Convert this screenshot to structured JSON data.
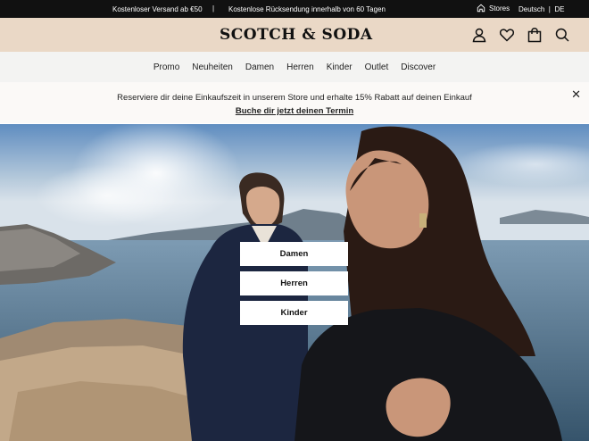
{
  "topbar": {
    "message_shipping": "Kostenloser Versand ab €50",
    "separator": "|",
    "message_returns": "Kostenlose Rücksendung innerhalb von 60 Tagen",
    "stores_label": "Stores",
    "stores_icon": "store-icon",
    "language": "Deutsch  |  DE"
  },
  "header": {
    "logo_text": "SCOTCH & SODA",
    "icons": [
      "account-icon",
      "heart-icon",
      "bag-icon",
      "search-icon"
    ]
  },
  "nav": {
    "items": [
      "Promo",
      "Neuheiten",
      "Damen",
      "Herren",
      "Kinder",
      "Outlet",
      "Discover"
    ]
  },
  "promo": {
    "text": "Reserviere dir deine Einkaufszeit in unserem Store und erhalte 15% Rabatt auf deinen Einkauf",
    "link": "Buche dir jetzt deinen Termin",
    "close_icon": "close-icon"
  },
  "hero": {
    "buttons": [
      "Damen",
      "Herren",
      "Kinder"
    ]
  },
  "colors": {
    "topbar": "#111111",
    "header": "#ead8c6",
    "nav": "#f3f3f2",
    "promo": "#fbf9f7"
  }
}
